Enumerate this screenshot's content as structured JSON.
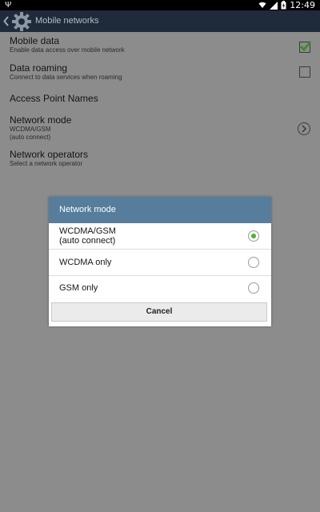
{
  "status_bar": {
    "time": "12:49",
    "icons": [
      "usb-icon",
      "wifi-icon",
      "signal-icon",
      "battery-icon"
    ]
  },
  "action_bar": {
    "title": "Mobile networks",
    "icons": [
      "back-icon",
      "settings-gear-icon"
    ]
  },
  "settings": {
    "mobile_data": {
      "title": "Mobile data",
      "subtitle": "Enable data access over mobile network",
      "checked": true
    },
    "data_roaming": {
      "title": "Data roaming",
      "subtitle": "Connect to data services when roaming",
      "checked": false
    },
    "apn": {
      "title": "Access Point Names"
    },
    "network_mode": {
      "title": "Network mode",
      "line1": "WCDMA/GSM",
      "line2": "(auto connect)"
    },
    "network_operators": {
      "title": "Network operators",
      "subtitle": "Select a network operator"
    }
  },
  "dialog": {
    "title": "Network mode",
    "options": [
      {
        "line1": "WCDMA/GSM",
        "line2": "(auto connect)",
        "selected": true
      },
      {
        "line1": "WCDMA only",
        "selected": false
      },
      {
        "line1": "GSM only",
        "selected": false
      }
    ],
    "cancel_label": "Cancel"
  },
  "colors": {
    "action_bar_bg": "#1f2b3a",
    "dialog_header_bg": "#567d9c",
    "accent_green": "#4cb12f"
  }
}
